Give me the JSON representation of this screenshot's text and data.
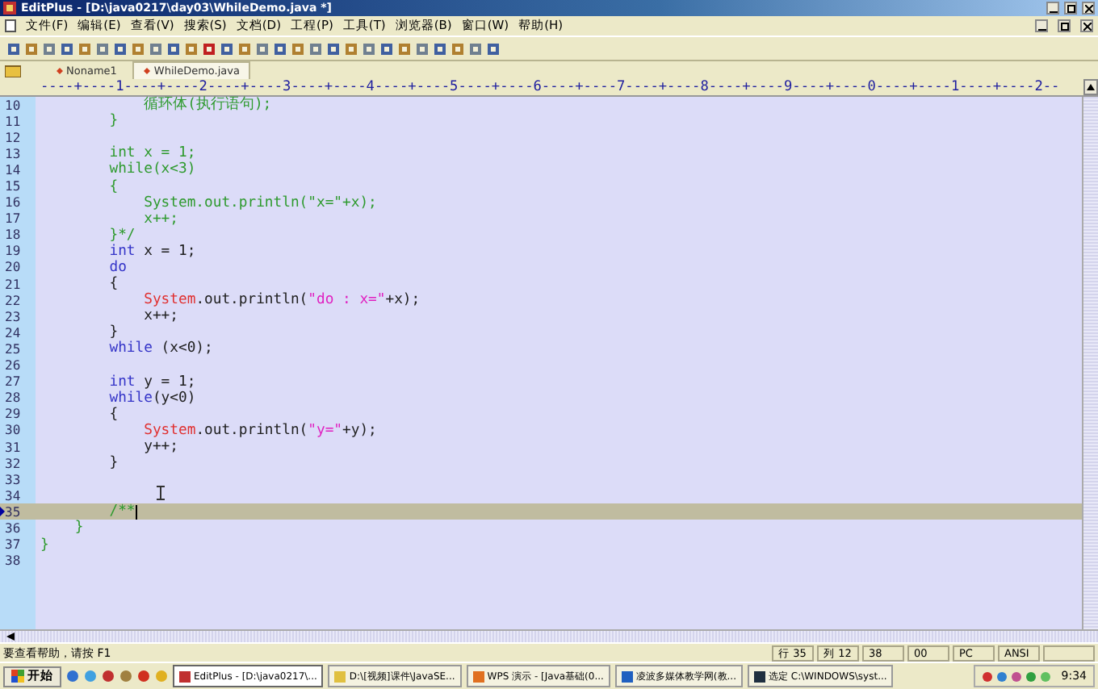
{
  "window": {
    "title": "EditPlus - [D:\\java0217\\day03\\WhileDemo.java *]"
  },
  "menu": [
    "文件(F)",
    "编辑(E)",
    "查看(V)",
    "搜索(S)",
    "文档(D)",
    "工程(P)",
    "工具(T)",
    "浏览器(B)",
    "窗口(W)",
    "帮助(H)"
  ],
  "tabs": [
    {
      "label": "Noname1",
      "selected": false
    },
    {
      "label": "WhileDemo.java",
      "selected": true
    }
  ],
  "ruler": "----+----1----+----2----+----3----+----4----+----5----+----6----+----7----+----8----+----9----+----0----+----1----+----2--",
  "lines": [
    {
      "num": "10",
      "current": false,
      "segments": [
        {
          "text": "            循环体(执行语句);",
          "kind": "comment"
        }
      ]
    },
    {
      "num": "11",
      "current": false,
      "segments": [
        {
          "text": "        }",
          "kind": "comment"
        }
      ]
    },
    {
      "num": "12",
      "current": false
    },
    {
      "num": "13",
      "current": false,
      "segments": [
        {
          "text": "        int x = 1;",
          "kind": "comment"
        }
      ]
    },
    {
      "num": "14",
      "current": false,
      "segments": [
        {
          "text": "        while(x<3)",
          "kind": "comment"
        }
      ]
    },
    {
      "num": "15",
      "current": false,
      "segments": [
        {
          "text": "        {",
          "kind": "comment"
        }
      ]
    },
    {
      "num": "16",
      "current": false,
      "segments": [
        {
          "text": "            System.out.println(\"x=\"+x);",
          "kind": "comment"
        }
      ]
    },
    {
      "num": "17",
      "current": false,
      "segments": [
        {
          "text": "            x++;",
          "kind": "comment"
        }
      ]
    },
    {
      "num": "18",
      "current": false,
      "segments": [
        {
          "text": "        }*/",
          "kind": "comment"
        }
      ]
    },
    {
      "num": "19",
      "current": false,
      "segments": [
        {
          "text": "        int",
          "kind": "keyword"
        },
        {
          "text": " x = 1;",
          "kind": "plain"
        }
      ]
    },
    {
      "num": "20",
      "current": false,
      "segments": [
        {
          "text": "        do",
          "kind": "keyword"
        }
      ]
    },
    {
      "num": "21",
      "current": false,
      "segments": [
        {
          "text": "        {",
          "kind": "plain"
        }
      ]
    },
    {
      "num": "22",
      "current": false,
      "segments": [
        {
          "text": "            System",
          "kind": "class"
        },
        {
          "text": ".out.println(",
          "kind": "plain"
        },
        {
          "text": "\"do : x=\"",
          "kind": "string"
        },
        {
          "text": "+x);",
          "kind": "plain"
        }
      ]
    },
    {
      "num": "23",
      "current": false,
      "segments": [
        {
          "text": "            x++;",
          "kind": "plain"
        }
      ]
    },
    {
      "num": "24",
      "current": false,
      "segments": [
        {
          "text": "        }",
          "kind": "plain"
        }
      ]
    },
    {
      "num": "25",
      "current": false,
      "segments": [
        {
          "text": "        while",
          "kind": "keyword"
        },
        {
          "text": " (x<0);",
          "kind": "plain"
        }
      ]
    },
    {
      "num": "26",
      "current": false
    },
    {
      "num": "27",
      "current": false,
      "segments": [
        {
          "text": "        int",
          "kind": "keyword"
        },
        {
          "text": " y = 1;",
          "kind": "plain"
        }
      ]
    },
    {
      "num": "28",
      "current": false,
      "segments": [
        {
          "text": "        while",
          "kind": "keyword"
        },
        {
          "text": "(y<0)",
          "kind": "plain"
        }
      ]
    },
    {
      "num": "29",
      "current": false,
      "segments": [
        {
          "text": "        {",
          "kind": "plain"
        }
      ]
    },
    {
      "num": "30",
      "current": false,
      "segments": [
        {
          "text": "            System",
          "kind": "class"
        },
        {
          "text": ".out.println(",
          "kind": "plain"
        },
        {
          "text": "\"y=\"",
          "kind": "string"
        },
        {
          "text": "+y);",
          "kind": "plain"
        }
      ]
    },
    {
      "num": "31",
      "current": false,
      "segments": [
        {
          "text": "            y++;",
          "kind": "plain"
        }
      ]
    },
    {
      "num": "32",
      "current": false,
      "segments": [
        {
          "text": "        }",
          "kind": "plain"
        }
      ]
    },
    {
      "num": "33",
      "current": false
    },
    {
      "num": "34",
      "current": false
    },
    {
      "num": "35",
      "current": true,
      "segments": [
        {
          "text": "        /**",
          "kind": "comment"
        }
      ]
    },
    {
      "num": "36",
      "current": false,
      "segments": [
        {
          "text": "    }",
          "kind": "comment"
        }
      ]
    },
    {
      "num": "37",
      "current": false,
      "segments": [
        {
          "text": "}",
          "kind": "comment"
        }
      ]
    },
    {
      "num": "38",
      "current": false
    }
  ],
  "status_bar": {
    "hint": "要查看帮助，请按 F1",
    "fields": [
      "行 35",
      "列 12",
      "38",
      "00",
      "PC",
      "ANSI"
    ]
  },
  "taskbar": {
    "start": "开始",
    "tasks": [
      "EditPlus - [D:\\java0217\\...",
      "D:\\[视频]课件\\JavaSE...",
      "WPS 演示 - [Java基础(0...",
      "凌波多媒体教学网(教...",
      "选定 C:\\WINDOWS\\syst..."
    ],
    "clock": "9:34"
  }
}
